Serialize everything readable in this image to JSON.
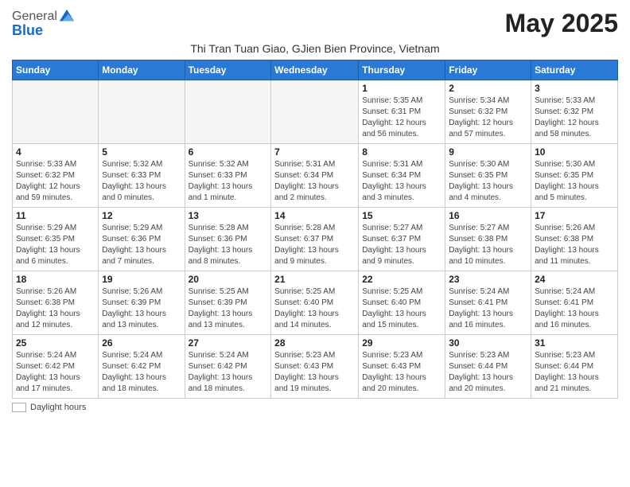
{
  "header": {
    "logo_general": "General",
    "logo_blue": "Blue",
    "title": "May 2025",
    "subtitle": "Thi Tran Tuan Giao, GJien Bien Province, Vietnam"
  },
  "days_of_week": [
    "Sunday",
    "Monday",
    "Tuesday",
    "Wednesday",
    "Thursday",
    "Friday",
    "Saturday"
  ],
  "weeks": [
    [
      {
        "day": "",
        "info": ""
      },
      {
        "day": "",
        "info": ""
      },
      {
        "day": "",
        "info": ""
      },
      {
        "day": "",
        "info": ""
      },
      {
        "day": "1",
        "info": "Sunrise: 5:35 AM\nSunset: 6:31 PM\nDaylight: 12 hours\nand 56 minutes."
      },
      {
        "day": "2",
        "info": "Sunrise: 5:34 AM\nSunset: 6:32 PM\nDaylight: 12 hours\nand 57 minutes."
      },
      {
        "day": "3",
        "info": "Sunrise: 5:33 AM\nSunset: 6:32 PM\nDaylight: 12 hours\nand 58 minutes."
      }
    ],
    [
      {
        "day": "4",
        "info": "Sunrise: 5:33 AM\nSunset: 6:32 PM\nDaylight: 12 hours\nand 59 minutes."
      },
      {
        "day": "5",
        "info": "Sunrise: 5:32 AM\nSunset: 6:33 PM\nDaylight: 13 hours\nand 0 minutes."
      },
      {
        "day": "6",
        "info": "Sunrise: 5:32 AM\nSunset: 6:33 PM\nDaylight: 13 hours\nand 1 minute."
      },
      {
        "day": "7",
        "info": "Sunrise: 5:31 AM\nSunset: 6:34 PM\nDaylight: 13 hours\nand 2 minutes."
      },
      {
        "day": "8",
        "info": "Sunrise: 5:31 AM\nSunset: 6:34 PM\nDaylight: 13 hours\nand 3 minutes."
      },
      {
        "day": "9",
        "info": "Sunrise: 5:30 AM\nSunset: 6:35 PM\nDaylight: 13 hours\nand 4 minutes."
      },
      {
        "day": "10",
        "info": "Sunrise: 5:30 AM\nSunset: 6:35 PM\nDaylight: 13 hours\nand 5 minutes."
      }
    ],
    [
      {
        "day": "11",
        "info": "Sunrise: 5:29 AM\nSunset: 6:35 PM\nDaylight: 13 hours\nand 6 minutes."
      },
      {
        "day": "12",
        "info": "Sunrise: 5:29 AM\nSunset: 6:36 PM\nDaylight: 13 hours\nand 7 minutes."
      },
      {
        "day": "13",
        "info": "Sunrise: 5:28 AM\nSunset: 6:36 PM\nDaylight: 13 hours\nand 8 minutes."
      },
      {
        "day": "14",
        "info": "Sunrise: 5:28 AM\nSunset: 6:37 PM\nDaylight: 13 hours\nand 9 minutes."
      },
      {
        "day": "15",
        "info": "Sunrise: 5:27 AM\nSunset: 6:37 PM\nDaylight: 13 hours\nand 9 minutes."
      },
      {
        "day": "16",
        "info": "Sunrise: 5:27 AM\nSunset: 6:38 PM\nDaylight: 13 hours\nand 10 minutes."
      },
      {
        "day": "17",
        "info": "Sunrise: 5:26 AM\nSunset: 6:38 PM\nDaylight: 13 hours\nand 11 minutes."
      }
    ],
    [
      {
        "day": "18",
        "info": "Sunrise: 5:26 AM\nSunset: 6:38 PM\nDaylight: 13 hours\nand 12 minutes."
      },
      {
        "day": "19",
        "info": "Sunrise: 5:26 AM\nSunset: 6:39 PM\nDaylight: 13 hours\nand 13 minutes."
      },
      {
        "day": "20",
        "info": "Sunrise: 5:25 AM\nSunset: 6:39 PM\nDaylight: 13 hours\nand 13 minutes."
      },
      {
        "day": "21",
        "info": "Sunrise: 5:25 AM\nSunset: 6:40 PM\nDaylight: 13 hours\nand 14 minutes."
      },
      {
        "day": "22",
        "info": "Sunrise: 5:25 AM\nSunset: 6:40 PM\nDaylight: 13 hours\nand 15 minutes."
      },
      {
        "day": "23",
        "info": "Sunrise: 5:24 AM\nSunset: 6:41 PM\nDaylight: 13 hours\nand 16 minutes."
      },
      {
        "day": "24",
        "info": "Sunrise: 5:24 AM\nSunset: 6:41 PM\nDaylight: 13 hours\nand 16 minutes."
      }
    ],
    [
      {
        "day": "25",
        "info": "Sunrise: 5:24 AM\nSunset: 6:42 PM\nDaylight: 13 hours\nand 17 minutes."
      },
      {
        "day": "26",
        "info": "Sunrise: 5:24 AM\nSunset: 6:42 PM\nDaylight: 13 hours\nand 18 minutes."
      },
      {
        "day": "27",
        "info": "Sunrise: 5:24 AM\nSunset: 6:42 PM\nDaylight: 13 hours\nand 18 minutes."
      },
      {
        "day": "28",
        "info": "Sunrise: 5:23 AM\nSunset: 6:43 PM\nDaylight: 13 hours\nand 19 minutes."
      },
      {
        "day": "29",
        "info": "Sunrise: 5:23 AM\nSunset: 6:43 PM\nDaylight: 13 hours\nand 20 minutes."
      },
      {
        "day": "30",
        "info": "Sunrise: 5:23 AM\nSunset: 6:44 PM\nDaylight: 13 hours\nand 20 minutes."
      },
      {
        "day": "31",
        "info": "Sunrise: 5:23 AM\nSunset: 6:44 PM\nDaylight: 13 hours\nand 21 minutes."
      }
    ]
  ],
  "footer": {
    "daylight_label": "Daylight hours"
  }
}
